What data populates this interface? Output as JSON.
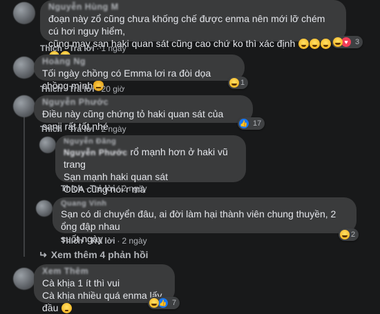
{
  "comments": [
    {
      "author": "Nguyễn Hùng M",
      "lines": [
        "đoạn này zổ cũng chưa khống chế được enma nên mới lỡ chém cú hơi nguy hiểm,",
        "cũng may sạn haki quan sát cũng cao chứ ko thì xác định"
      ],
      "emoji_trail": [
        "sweat-smile-emoji",
        "sweat-smile-emoji",
        "sweat-smile-emoji",
        "sweat-smile-emoji",
        "sweat-smile-emoji"
      ],
      "like_label": "Thích",
      "reply_label": "Trả lời",
      "time": "1 ngày",
      "reaction_count": "3"
    },
    {
      "author": "Hoàng Ng",
      "lines": [
        "Tối ngày chồng có Emma lơi ra đòi dọa chồng mình"
      ],
      "emoji_trail": [
        "pouting-cat-emoji"
      ],
      "like_label": "Thích",
      "reply_label": "Trả lời",
      "time": "20 giờ",
      "reaction_count": "1"
    },
    {
      "author": "Nguyễn Phước",
      "lines": [
        "Điều này cũng chứng tỏ haki quan sát của sanji rất tốt nhé"
      ],
      "like_label": "Thích",
      "reply_label": "Trả lời",
      "time": "2 ngày",
      "reaction_count": "17"
    }
  ],
  "replies": [
    {
      "author": "Nguyễn Đăng",
      "tagged": "Nguyễn Phước",
      "lines": [
        "rổ mạnh hơn ở haki vũ trang",
        "Sạn mạnh haki quan sát",
        "ODA cũng nói r mà"
      ],
      "like_label": "Thích",
      "reply_label": "Trả lời",
      "time": "2 ngày"
    },
    {
      "author": "Quang Vinh",
      "lines": [
        "Sạn có di chuyển đâu, ai đời làm hại thành viên chung thuyền, 2 ổng đập nhau",
        "suốt ngày"
      ],
      "like_label": "Thích",
      "reply_label": "Trả lời",
      "time": "2 ngày",
      "reaction_count": "2"
    }
  ],
  "more_replies": "Xem thêm 4 phản hồi",
  "last_comment": {
    "author": "Xem Thêm",
    "lines": [
      "Cà khịa 1 ít thì vui",
      "Cà khịa nhiều quá enma lấy đầu"
    ],
    "emoji_trail": [
      "sad-emoji"
    ],
    "reaction_count": "7"
  },
  "colors": {
    "background": "#18191a",
    "bubble": "#3a3b3c",
    "text": "#e4e6eb",
    "secondary_text": "#b0b3b8"
  }
}
